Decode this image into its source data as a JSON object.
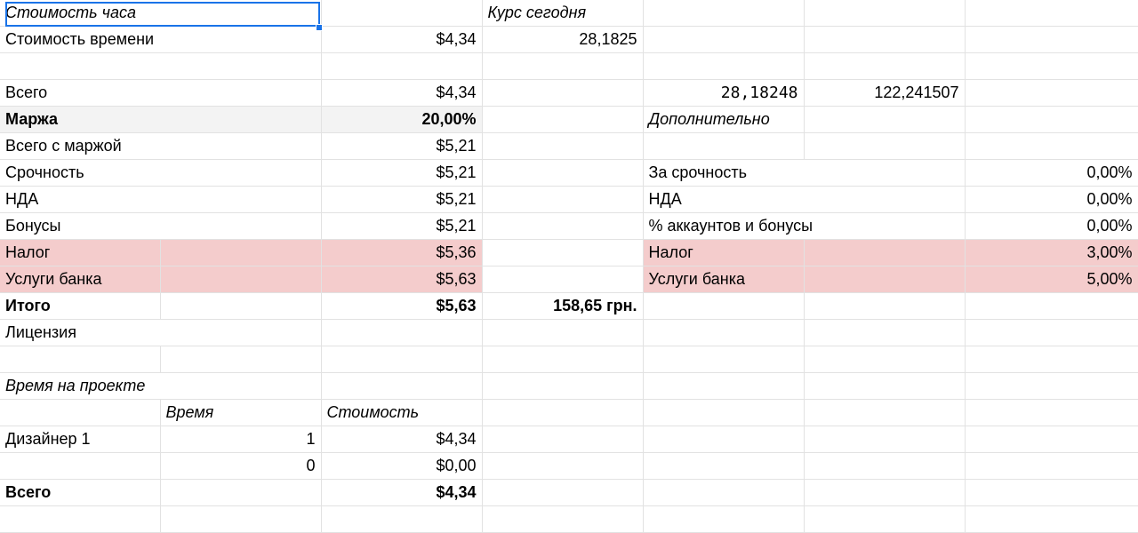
{
  "cells": {
    "r1": {
      "a": "Стоимость часа",
      "d": "Курс сегодня"
    },
    "r2": {
      "a": "Стоимость времени",
      "c": "$4,34",
      "d": "28,1825"
    },
    "r4": {
      "a": "Всего",
      "c": "$4,34",
      "e": "28,18248",
      "f": "122,241507"
    },
    "r5": {
      "a": "Маржа",
      "c": "20,00%",
      "e": "Дополнительно"
    },
    "r6": {
      "a": "Всего с маржой",
      "c": "$5,21"
    },
    "r7": {
      "a": "Срочность",
      "c": "$5,21",
      "e": "За срочность",
      "g": "0,00%"
    },
    "r8": {
      "a": "НДА",
      "c": "$5,21",
      "e": "НДА",
      "g": "0,00%"
    },
    "r9": {
      "a": "Бонусы",
      "c": "$5,21",
      "e": "% аккаунтов и бонусы",
      "g": "0,00%"
    },
    "r10": {
      "a": "Налог",
      "c": "$5,36",
      "e": "Налог",
      "g": "3,00%"
    },
    "r11": {
      "a": "Услуги банка",
      "c": "$5,63",
      "e": "Услуги банка",
      "g": "5,00%"
    },
    "r12": {
      "a": "Итого",
      "c": "$5,63",
      "d": "158,65 грн."
    },
    "r13": {
      "a": "Лицензия"
    },
    "r15": {
      "a": "Время на проекте"
    },
    "r16": {
      "b": "Время",
      "c": "Стоимость"
    },
    "r17": {
      "a": "Дизайнер 1",
      "b": "1",
      "c": "$4,34"
    },
    "r18": {
      "b": "0",
      "c": "$0,00"
    },
    "r19": {
      "a": "Всего",
      "c": "$4,34"
    }
  },
  "colors": {
    "selection": "#1a73e8",
    "highlight_pink": "#f4cccc",
    "highlight_grey": "#f3f3f3",
    "gridline": "#e2e2e2"
  }
}
